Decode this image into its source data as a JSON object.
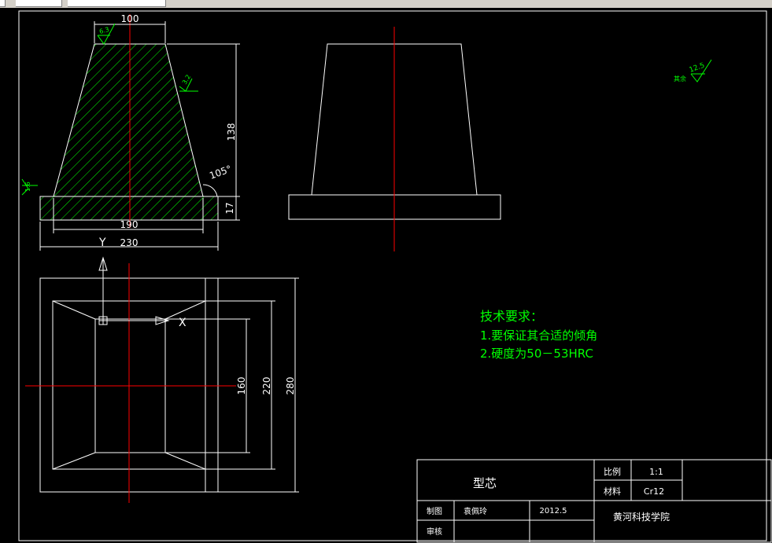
{
  "part": {
    "dim_top_width": "100",
    "dim_height": "138",
    "dim_base_height": "17",
    "dim_inner_base": "190",
    "dim_outer_base": "230",
    "angle": "105°",
    "rough_top": "6.3",
    "rough_side": "3.2",
    "rough_left": "1.6",
    "rough_general_value": "12.5",
    "rough_general_label": "其余",
    "dim_plan_160": "160",
    "dim_plan_220": "220",
    "dim_plan_280": "280",
    "axis_y": "Y",
    "axis_x": "X"
  },
  "tech_notes": {
    "title": "技术要求：",
    "item1": "1.要保证其合适的倾角",
    "item2": "2.硬度为50－53HRC"
  },
  "title_block": {
    "part_name": "型芯",
    "scale_label": "比例",
    "scale_value": "1:1",
    "material_label": "材料",
    "material_value": "Cr12",
    "drawn_label": "制图",
    "drawn_by": "袁佩玲",
    "date": "2012.5",
    "checked_label": "审核",
    "school": "黄河科技学院"
  },
  "colors": {
    "background": "#000000",
    "lines": "#ffffff",
    "centerline": "#ff0000",
    "hatch_and_notes": "#00ff00"
  }
}
